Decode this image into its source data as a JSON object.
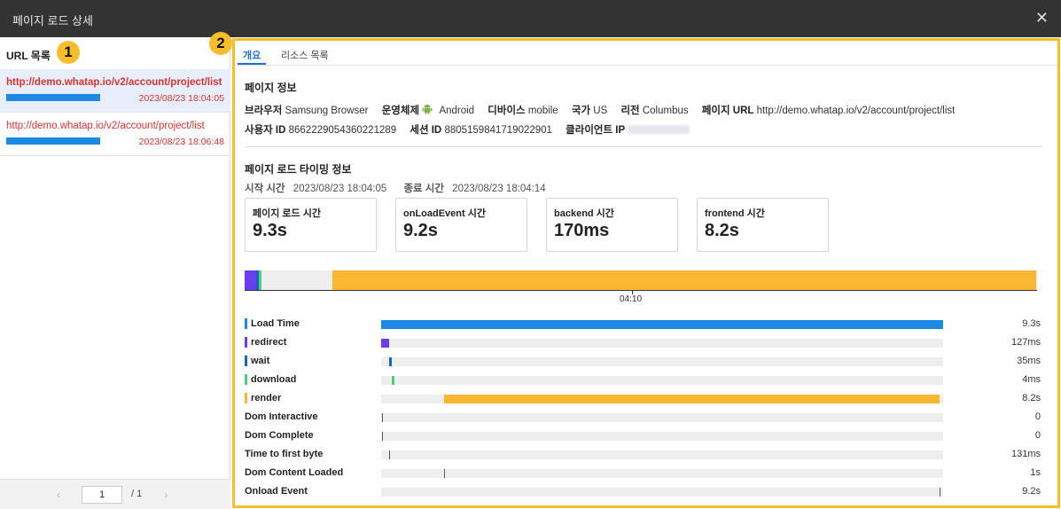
{
  "window": {
    "title": "페이지 로드 상세",
    "close_icon": "close-icon"
  },
  "left": {
    "header": "URL 목록",
    "badge": "1",
    "items": [
      {
        "url": "http://demo.whatap.io/v2/account/project/list",
        "date": "2023/08/23 18:04:05",
        "selected": true
      },
      {
        "url": "http://demo.whatap.io/v2/account/project/list",
        "date": "2023/08/23 18:06:48",
        "selected": false
      }
    ],
    "pager": {
      "prev": "‹",
      "current": "1",
      "total": "/ 1",
      "next": "›"
    }
  },
  "right": {
    "badge": "2",
    "tabs": [
      {
        "label": "개요",
        "active": true
      },
      {
        "label": "리소스 목록",
        "active": false
      }
    ],
    "page_info": {
      "title": "페이지 정보",
      "browser_label": "브라우저",
      "browser": "Samsung Browser",
      "os_label": "운영체제",
      "os": "Android",
      "device_label": "디바이스",
      "device": "mobile",
      "country_label": "국가",
      "country": "US",
      "region_label": "리전",
      "region": "Columbus",
      "page_url_label": "페이지 URL",
      "page_url": "http://demo.whatap.io/v2/account/project/list",
      "user_id_label": "사용자 ID",
      "user_id": "8662229054360221289",
      "session_id_label": "세션 ID",
      "session_id": "8805159841719022901",
      "client_ip_label": "클라이언트 IP"
    },
    "timing": {
      "title": "페이지 로드 타이밍 정보",
      "start_label": "시작 시간",
      "start": "2023/08/23 18:04:05",
      "end_label": "종료 시간",
      "end": "2023/08/23 18:04:14",
      "cards": [
        {
          "label": "페이지 로드 시간",
          "value": "9.3s"
        },
        {
          "label": "onLoadEvent 시간",
          "value": "9.2s"
        },
        {
          "label": "backend 시간",
          "value": "170ms"
        },
        {
          "label": "frontend 시간",
          "value": "8.2s"
        }
      ],
      "timeline_tick": "04:10"
    },
    "metrics": [
      {
        "name": "Load Time",
        "value": "9.3s",
        "color": "#1e88e5"
      },
      {
        "name": "redirect",
        "value": "127ms",
        "color": "#6a3df0"
      },
      {
        "name": "wait",
        "value": "35ms",
        "color": "#1565c0"
      },
      {
        "name": "download",
        "value": "4ms",
        "color": "#4cd07d"
      },
      {
        "name": "render",
        "value": "8.2s",
        "color": "#fbb731"
      },
      {
        "name": "Dom Interactive",
        "value": "0"
      },
      {
        "name": "Dom Complete",
        "value": "0"
      },
      {
        "name": "Time to first byte",
        "value": "131ms"
      },
      {
        "name": "Dom Content Loaded",
        "value": "1s"
      },
      {
        "name": "Onload Event",
        "value": "9.2s"
      }
    ]
  }
}
